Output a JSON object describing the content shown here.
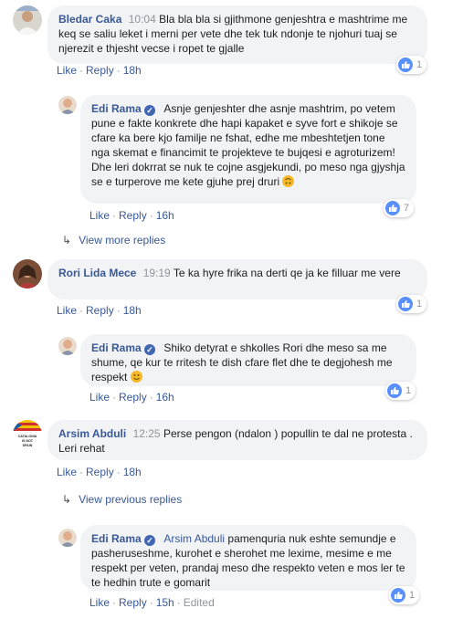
{
  "colors": {
    "link": "#385898",
    "meta": "#90949c",
    "bubble": "#f2f3f5",
    "like_blue": "#5890ff"
  },
  "comments": [
    {
      "author": "Bledar Caka",
      "time": "10:04",
      "text": "Bla bla bla si gjithmone genjeshtra e mashtrime me keq se saliu leket i merni per vete dhe tek tuk ndonje te njohuri tuaj se njerezit e thjesht vecse i ropet te gjalle",
      "like": "Like",
      "reply": "Reply",
      "age": "18h",
      "reactions": "1"
    },
    {
      "author": "Edi Rama",
      "text": "Asnje genjeshter dhe asnje mashtrim, po vetem pune e fakte konkrete dhe hapi kapaket e syve fort e shikoje se cfare ka bere kjo familje ne fshat, edhe me mbeshtetjen tone nga skemat e financimit te projekteve te bujqesi e agroturizem! Dhe leri dokrrat se nuk te cojne asgjekundi, po meso nga gjyshja se e turperove me kete gjuhe prej druri",
      "emoji": "upside-down-face",
      "like": "Like",
      "reply": "Reply",
      "age": "16h",
      "reactions": "7"
    },
    {
      "author": "Rori Lida Mece",
      "time": "19:19",
      "text": "Te ka hyre frika na derti qe ja ke filluar me vere",
      "like": "Like",
      "reply": "Reply",
      "age": "18h",
      "reactions": "1"
    },
    {
      "author": "Edi Rama",
      "text": "Shiko detyrat e shkolles Rori dhe meso sa me shume, qe kur te rritesh te dish cfare flet dhe te degjohesh me respekt",
      "emoji": "smiling-face",
      "like": "Like",
      "reply": "Reply",
      "age": "16h",
      "reactions": "1"
    },
    {
      "author": "Arsim Abduli",
      "time": "12:25",
      "text": "Perse pengon (ndalon ) popullin te dal ne protesta . Leri rehat",
      "like": "Like",
      "reply": "Reply",
      "age": "18h",
      "avatar_text": "CATALONIA IS NOT SPAIN"
    },
    {
      "author": "Edi Rama",
      "tag": "Arsim Abduli",
      "text": "pamenquria nuk eshte semundje e pasheruseshme, kurohet e sherohet me lexime, mesime e me respekt per veten, prandaj meso dhe respekto veten e mos ler te te hedhin trute e gomarit",
      "like": "Like",
      "reply": "Reply",
      "age": "15h",
      "edited": "Edited",
      "reactions": "1"
    }
  ],
  "view_more_replies": "View more replies",
  "view_previous_replies": "View previous replies"
}
